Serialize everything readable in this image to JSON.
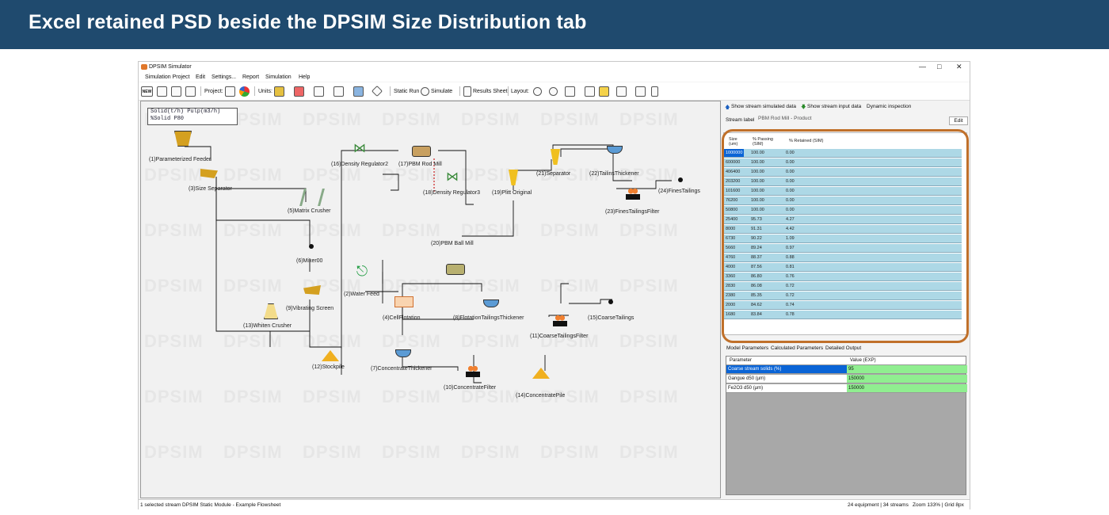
{
  "banner": {
    "title": "Excel retained PSD beside the DPSIM Size Distribution tab"
  },
  "window": {
    "title": "DPSIM Simulator"
  },
  "menu": [
    "Simulation Project",
    "Edit",
    "Settings...",
    "Report",
    "Simulation",
    "Help"
  ],
  "toolbar": {
    "project_label": "Project:",
    "units_label": "Units:",
    "static_run": "Static Run",
    "simulate": "Simulate",
    "results_sheet": "Results Sheet",
    "layout_label": "Layout:"
  },
  "legend": {
    "line1": "Solid(t/h)   Pulp(m3/h)",
    "line2": "%Solid   P80"
  },
  "watermark": "DPSIM",
  "flowsheet": {
    "units": [
      "(1)Parameterized Feeder",
      "(3)Size Separator",
      "(5)Matrix Crusher",
      "(6)Mixer00",
      "(9)Vibrating Screen",
      "(13)Whiten Crusher",
      "(12)Stockpile",
      "(16)Density Regulator2",
      "(17)PBM Rod Mill",
      "(18)Density Regulator3",
      "(19)Plitt Original",
      "(20)PBM Ball Mill",
      "(21)Separator",
      "(22)TailinsThickener",
      "(23)FinesTailingsFilter",
      "(24)FinesTailings",
      "(2)Water Feed",
      "(4)CellFlotation",
      "(8)FlotationTailingsThickener",
      "(11)CoarseTailingsFilter",
      "(15)CoarseTailings",
      "(7)ConcentrateThickener",
      "(10)ConcentrateFilter",
      "(14)ConcentratePile"
    ]
  },
  "panel": {
    "show_sim": "Show stream simulated data",
    "show_input": "Show stream input data",
    "dynamic": "Dynamic inspection",
    "stream_label": "Stream label",
    "stream_value": "PBM Rod Mill - Product",
    "edit": "Edit",
    "psd_headers": [
      "Size (um)",
      "% Passing (SIM)",
      "% Retained (SIM)"
    ],
    "psd_rows": [
      [
        "1000000",
        "100.00",
        "0.00"
      ],
      [
        "600000",
        "100.00",
        "0.00"
      ],
      [
        "406400",
        "100.00",
        "0.00"
      ],
      [
        "203200",
        "100.00",
        "0.00"
      ],
      [
        "101600",
        "100.00",
        "0.00"
      ],
      [
        "76200",
        "100.00",
        "0.00"
      ],
      [
        "50800",
        "100.00",
        "0.00"
      ],
      [
        "25400",
        "95.73",
        "4.27"
      ],
      [
        "8000",
        "91.31",
        "4.42"
      ],
      [
        "6730",
        "90.22",
        "1.09"
      ],
      [
        "5660",
        "89.24",
        "0.97"
      ],
      [
        "4760",
        "88.37",
        "0.88"
      ],
      [
        "4000",
        "87.56",
        "0.81"
      ],
      [
        "3360",
        "86.80",
        "0.76"
      ],
      [
        "2830",
        "86.08",
        "0.72"
      ],
      [
        "2380",
        "85.35",
        "0.72"
      ],
      [
        "2000",
        "84.62",
        "0.74"
      ],
      [
        "1680",
        "83.84",
        "0.78"
      ]
    ],
    "tabs": [
      "Model Parameters",
      "Calculated Parameters",
      "Detailed Output"
    ],
    "mp_headers": [
      "Parameter",
      "Value (EXP)"
    ],
    "mp_rows": [
      [
        "Coarse stream solids (%)",
        "95"
      ],
      [
        "Gangue d50 (µm)",
        "150000"
      ],
      [
        "Fe2O3 d50 (µm)",
        "150000"
      ]
    ]
  },
  "status": {
    "left": "1 selected stream",
    "module": "DPSIM Static Module - Example Flowsheet",
    "equip": "24 equipment | 34 streams",
    "zoom": "Zoom 133% | Grid 8px"
  }
}
